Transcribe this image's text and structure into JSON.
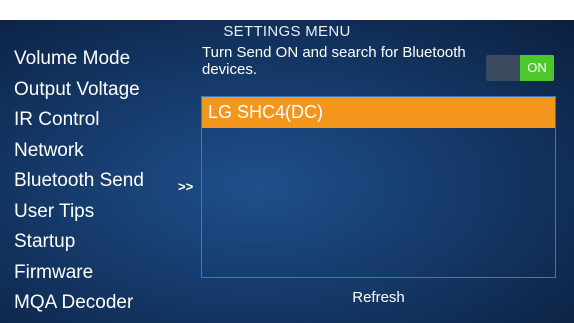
{
  "header": {
    "title": "SETTINGS MENU"
  },
  "menu": {
    "items": [
      {
        "label": "Volume Mode"
      },
      {
        "label": "Output Voltage"
      },
      {
        "label": "IR Control"
      },
      {
        "label": "Network"
      },
      {
        "label": "Bluetooth Send"
      },
      {
        "label": "User Tips"
      },
      {
        "label": "Startup"
      },
      {
        "label": "Firmware"
      },
      {
        "label": "MQA Decoder"
      }
    ],
    "selected_indicator": ">>"
  },
  "bluetooth": {
    "instruction": "Turn Send ON and search for Bluetooth devices.",
    "toggle_label": "ON",
    "devices": [
      {
        "name": "LG SHC4(DC)"
      }
    ],
    "refresh_label": "Refresh"
  },
  "colors": {
    "accent": "#f2971c",
    "toggle_on": "#4cc82c",
    "background": "#153a6b"
  }
}
